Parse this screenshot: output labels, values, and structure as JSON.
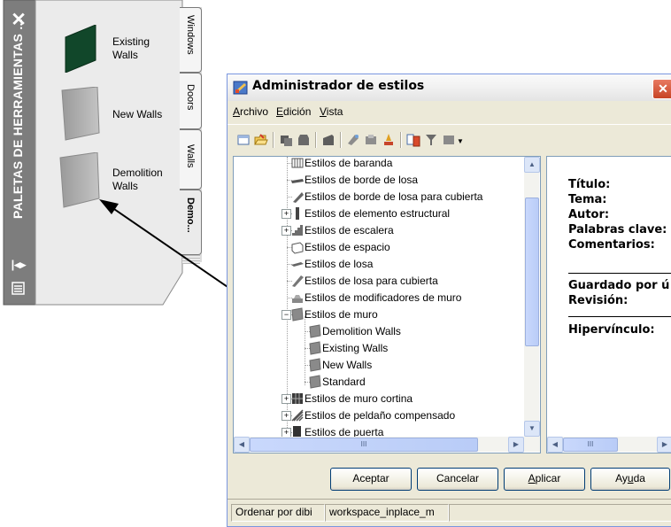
{
  "palette": {
    "title": "PALETAS DE HERRAMIENTAS ...",
    "tools": [
      {
        "label": "Existing Walls"
      },
      {
        "label": "New Walls"
      },
      {
        "label": "Demolition Walls"
      }
    ],
    "tabs": [
      "Windows",
      "Doors",
      "Walls",
      "Demo..."
    ],
    "active_tab": "Demo..."
  },
  "dialog": {
    "title": "Administrador de estilos",
    "menu": [
      {
        "accel": "A",
        "rest": "rchivo"
      },
      {
        "accel": "E",
        "rest": "dición"
      },
      {
        "accel": "V",
        "rest": "ista"
      }
    ],
    "tree": [
      {
        "label": "Estilos de baranda",
        "icon": "railing-style-icon",
        "expander": "",
        "level": 1
      },
      {
        "label": "Estilos de borde de losa",
        "icon": "slab-edge-style-icon",
        "expander": "",
        "level": 1
      },
      {
        "label": "Estilos de borde de losa para cubierta",
        "icon": "roof-slab-edge-style-icon",
        "expander": "",
        "level": 1
      },
      {
        "label": "Estilos de elemento estructural",
        "icon": "structural-member-style-icon",
        "expander": "+",
        "level": 1
      },
      {
        "label": "Estilos de escalera",
        "icon": "stair-style-icon",
        "expander": "+",
        "level": 1
      },
      {
        "label": "Estilos de espacio",
        "icon": "space-style-icon",
        "expander": "",
        "level": 1
      },
      {
        "label": "Estilos de losa",
        "icon": "slab-style-icon",
        "expander": "",
        "level": 1
      },
      {
        "label": "Estilos de losa para cubierta",
        "icon": "roof-slab-style-icon",
        "expander": "",
        "level": 1
      },
      {
        "label": "Estilos de modificadores de muro",
        "icon": "wall-modifier-style-icon",
        "expander": "",
        "level": 1
      },
      {
        "label": "Estilos de muro",
        "icon": "wall-style-icon",
        "expander": "−",
        "level": 1
      },
      {
        "label": "Demolition Walls",
        "icon": "wall-style-icon",
        "expander": "",
        "level": 2
      },
      {
        "label": "Existing Walls",
        "icon": "wall-style-icon",
        "expander": "",
        "level": 2
      },
      {
        "label": "New Walls",
        "icon": "wall-style-icon",
        "expander": "",
        "level": 2
      },
      {
        "label": "Standard",
        "icon": "wall-style-icon",
        "expander": "",
        "level": 2
      },
      {
        "label": "Estilos de muro cortina",
        "icon": "curtain-wall-style-icon",
        "expander": "+",
        "level": 1
      },
      {
        "label": "Estilos de peldaño compensado",
        "icon": "winder-style-icon",
        "expander": "+",
        "level": 1
      },
      {
        "label": "Estilos de puerta",
        "icon": "door-style-icon",
        "expander": "+",
        "level": 1
      }
    ],
    "preview": {
      "fields": [
        "Título:",
        "Tema:",
        "Autor:",
        "Palabras clave:",
        "Comentarios:"
      ],
      "fields2": [
        "Guardado por ú",
        "Revisión:"
      ],
      "fields3": [
        "Hipervínculo:"
      ]
    },
    "buttons": {
      "ok": "Aceptar",
      "cancel": "Cancelar",
      "apply_accel": "A",
      "apply_rest": "plicar",
      "help_pre": "Ay",
      "help_accel": "u",
      "help_post": "da"
    },
    "status": [
      "Ordenar por dibi",
      "workspace_inplace_m"
    ],
    "hscroll_label": "III"
  },
  "colors": {
    "palette_strip": "#7f7f7f",
    "palette_body": "#ececec",
    "dialog_bg": "#ece9d8",
    "accent_blue": "#0a246a",
    "arrow": "#000000"
  }
}
